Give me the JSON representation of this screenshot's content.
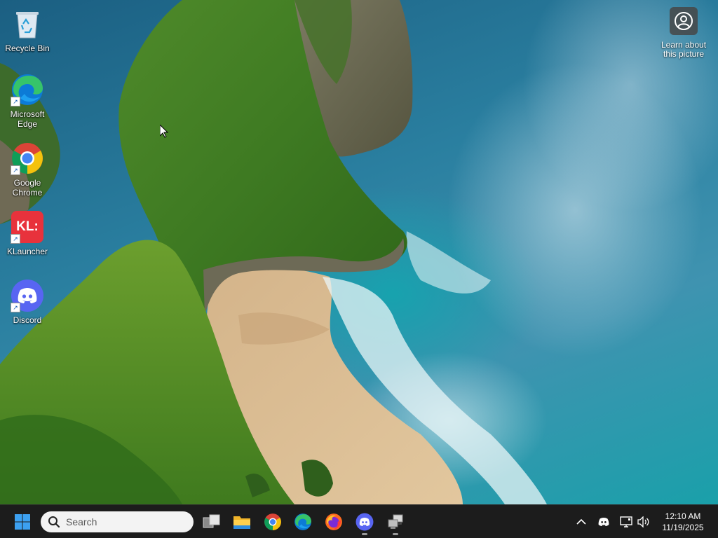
{
  "desktop": {
    "icons": [
      {
        "label": "Recycle Bin",
        "icon": "recycle-bin-icon"
      },
      {
        "label": "Microsoft Edge",
        "icon": "edge-icon"
      },
      {
        "label": "Google Chrome",
        "icon": "chrome-icon"
      },
      {
        "label": "KLauncher",
        "icon": "klauncher-icon",
        "glyph_text": "KL:"
      },
      {
        "label": "Discord",
        "icon": "discord-icon"
      }
    ],
    "learn_about": {
      "label": "Learn about this picture",
      "icon": "learn-about-picture-icon"
    }
  },
  "taskbar": {
    "search_placeholder": "Search",
    "apps": [
      {
        "name": "Start",
        "icon": "windows-start-icon"
      },
      {
        "name": "Task View",
        "icon": "task-view-icon"
      },
      {
        "name": "File Explorer",
        "icon": "file-explorer-icon"
      },
      {
        "name": "Google Chrome",
        "icon": "chrome-icon"
      },
      {
        "name": "Microsoft Edge",
        "icon": "edge-icon"
      },
      {
        "name": "Firefox",
        "icon": "firefox-icon"
      },
      {
        "name": "Discord",
        "icon": "discord-icon",
        "running": true
      },
      {
        "name": "Network Share",
        "icon": "network-share-icon",
        "running": true
      }
    ],
    "tray": [
      {
        "name": "Show hidden icons",
        "icon": "chevron-up-icon"
      },
      {
        "name": "Discord",
        "icon": "discord-tray-icon"
      },
      {
        "name": "Network",
        "icon": "network-icon"
      },
      {
        "name": "Volume",
        "icon": "volume-icon"
      }
    ],
    "clock": {
      "time": "12:10 AM",
      "date": "11/19/2025"
    }
  },
  "colors": {
    "taskbar_bg": "#1c1c1c",
    "discord_blurple": "#5865f2",
    "klauncher_red": "#e8323c",
    "windows_blue": "#0078d4"
  }
}
